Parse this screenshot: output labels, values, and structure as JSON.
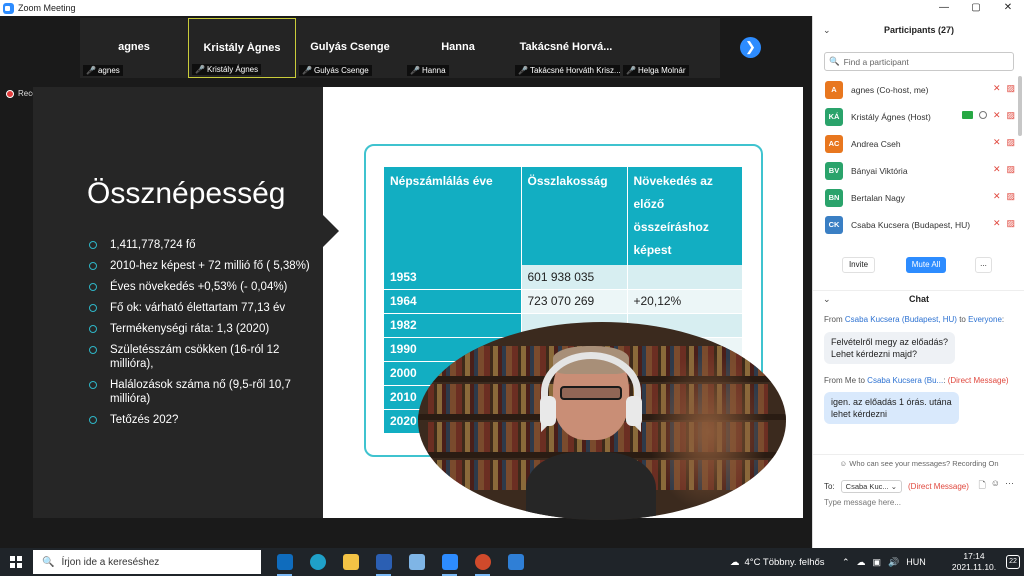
{
  "window": {
    "title": "Zoom Meeting",
    "buttons": [
      "—",
      "▢",
      "✕"
    ]
  },
  "thumbnails": [
    {
      "display": "agnes",
      "label": "agnes",
      "active": false
    },
    {
      "display": "Kristály Ágnes",
      "label": "Kristály Ágnes",
      "active": true
    },
    {
      "display": "Gulyás Csenge",
      "label": "Gulyás Csenge",
      "active": false
    },
    {
      "display": "Hanna",
      "label": "Hanna",
      "active": false
    },
    {
      "display": "Takácsné Horvá...",
      "label": "Takácsné Horváth Krisz...",
      "active": false
    },
    {
      "display": "",
      "label": "Helga Molnár",
      "active": false
    }
  ],
  "next_icon": "❯",
  "recording_label": "Recording",
  "slide": {
    "title": "Össznépesség",
    "bullets": [
      "1,411,778,724 fő",
      "2010-hez képest + 72 millió fő ( 5,38%)",
      "Éves növekedés +0,53% (- 0,04%)",
      "Fő ok: várható élettartam 77,13 év",
      "Termékenységi ráta: 1,3 (2020)",
      "Születésszám csökken (16-ról 12 millióra),",
      "Halálozások száma nő (9,5-ről 10,7 millióra)",
      "Tetőzés 202?"
    ],
    "table": {
      "headers": [
        "Népszámlálás éve",
        "Összlakosság",
        "Növekedés az előző összeíráshoz képest"
      ],
      "rows": [
        [
          "1953",
          "601 938 035",
          ""
        ],
        [
          "1964",
          "723 070 269",
          "+20,12%"
        ],
        [
          "1982",
          "",
          ""
        ],
        [
          "1990",
          "",
          ""
        ],
        [
          "2000",
          "",
          ""
        ],
        [
          "2010",
          "",
          ""
        ],
        [
          "2020",
          "",
          ""
        ]
      ]
    }
  },
  "participants": {
    "header": "Participants (27)",
    "search_placeholder": "Find a participant",
    "list": [
      {
        "initials": "A",
        "name": "agnes (Co-host, me)",
        "color": "#e8771f",
        "host": false
      },
      {
        "initials": "KÁ",
        "name": "Kristály Ágnes (Host)",
        "color": "#2aa36b",
        "host": true
      },
      {
        "initials": "AC",
        "name": "Andrea Cseh",
        "color": "#e8771f",
        "host": false
      },
      {
        "initials": "BV",
        "name": "Bányai Viktória",
        "color": "#2aa36b",
        "host": false
      },
      {
        "initials": "BN",
        "name": "Bertalan Nagy",
        "color": "#2aa36b",
        "host": false
      },
      {
        "initials": "CK",
        "name": "Csaba Kucsera (Budapest, HU)",
        "color": "#3a7fc4",
        "host": false
      }
    ],
    "invite": "Invite",
    "mute_all": "Mute All",
    "more": "..."
  },
  "chat": {
    "header": "Chat",
    "messages": [
      {
        "from_prefix": "From",
        "from": "Csaba Kucsera (Budapest, HU)",
        "to_prefix": "to",
        "to": "Everyone",
        "suffix": ":",
        "tag": "",
        "text_lines": [
          "Felvételről megy az előadás?",
          "Lehet kérdezni majd?"
        ],
        "mine": false
      },
      {
        "from_prefix": "From",
        "from": "Me",
        "to_prefix": "to",
        "to": "Csaba Kucsera (Bu...",
        "suffix": ":",
        "tag": "(Direct Message)",
        "text_lines": [
          "igen. az előadás 1 órás. utána",
          "lehet kérdezni"
        ],
        "mine": true
      }
    ],
    "notice": "Who can see your messages? Recording On",
    "to_label": "To:",
    "to_selected": "Csaba Kuc...",
    "to_tag": "(Direct Message)",
    "input_placeholder": "Type message here..."
  },
  "taskbar": {
    "search_placeholder": "Írjon ide a kereséshez",
    "apps": [
      {
        "name": "outlook",
        "color": "#0f6cbd",
        "open": true
      },
      {
        "name": "edge",
        "color": "#1fa0c8",
        "open": false
      },
      {
        "name": "file-explorer",
        "color": "#f3c345",
        "open": false
      },
      {
        "name": "word",
        "color": "#2b5fb3",
        "open": true
      },
      {
        "name": "notepad",
        "color": "#7fb5e6",
        "open": false
      },
      {
        "name": "zoom",
        "color": "#2d8cff",
        "open": true
      },
      {
        "name": "powerpoint",
        "color": "#d04a2b",
        "open": true
      },
      {
        "name": "media",
        "color": "#2f7fd6",
        "open": false
      }
    ],
    "weather": "4°C  Többny. felhős",
    "tray_lang": "HUN",
    "time": "17:14",
    "date": "2021.11.10.",
    "notifications": "22"
  }
}
